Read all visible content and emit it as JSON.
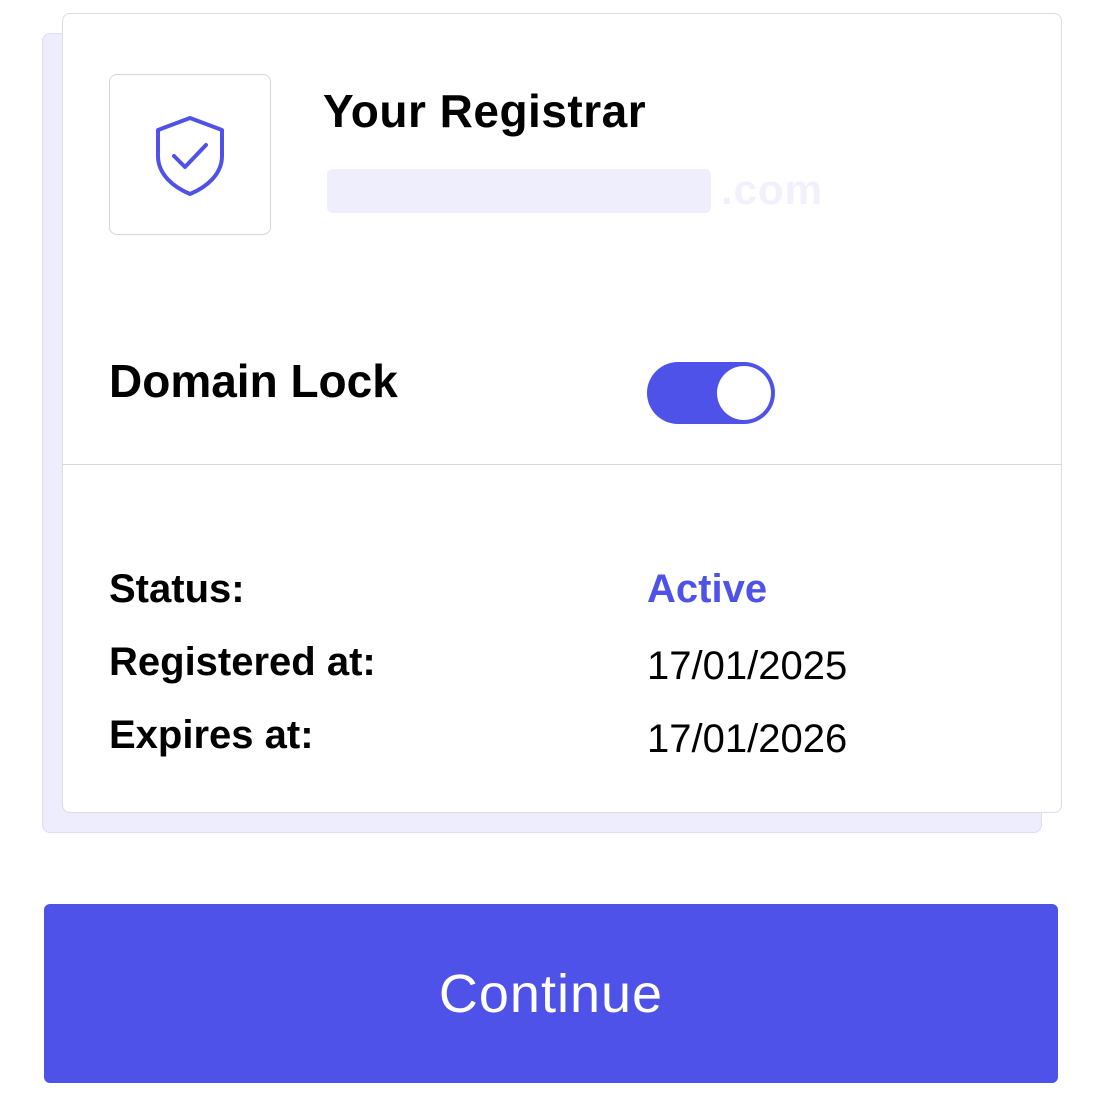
{
  "registrar": {
    "title": "Your Registrar",
    "domain_tld": ".com"
  },
  "lock": {
    "label": "Domain Lock",
    "enabled": true
  },
  "info": {
    "status_label": "Status:",
    "status_value": "Active",
    "registered_label": "Registered at:",
    "registered_value": "17/01/2025",
    "expires_label": "Expires at:",
    "expires_value": "17/01/2026"
  },
  "actions": {
    "continue_label": "Continue"
  },
  "colors": {
    "accent": "#4f52e8",
    "card_shadow": "#eeedfd",
    "domain_mask": "#eeeefc"
  },
  "icons": {
    "registrar_logo": "shield-check-icon"
  }
}
